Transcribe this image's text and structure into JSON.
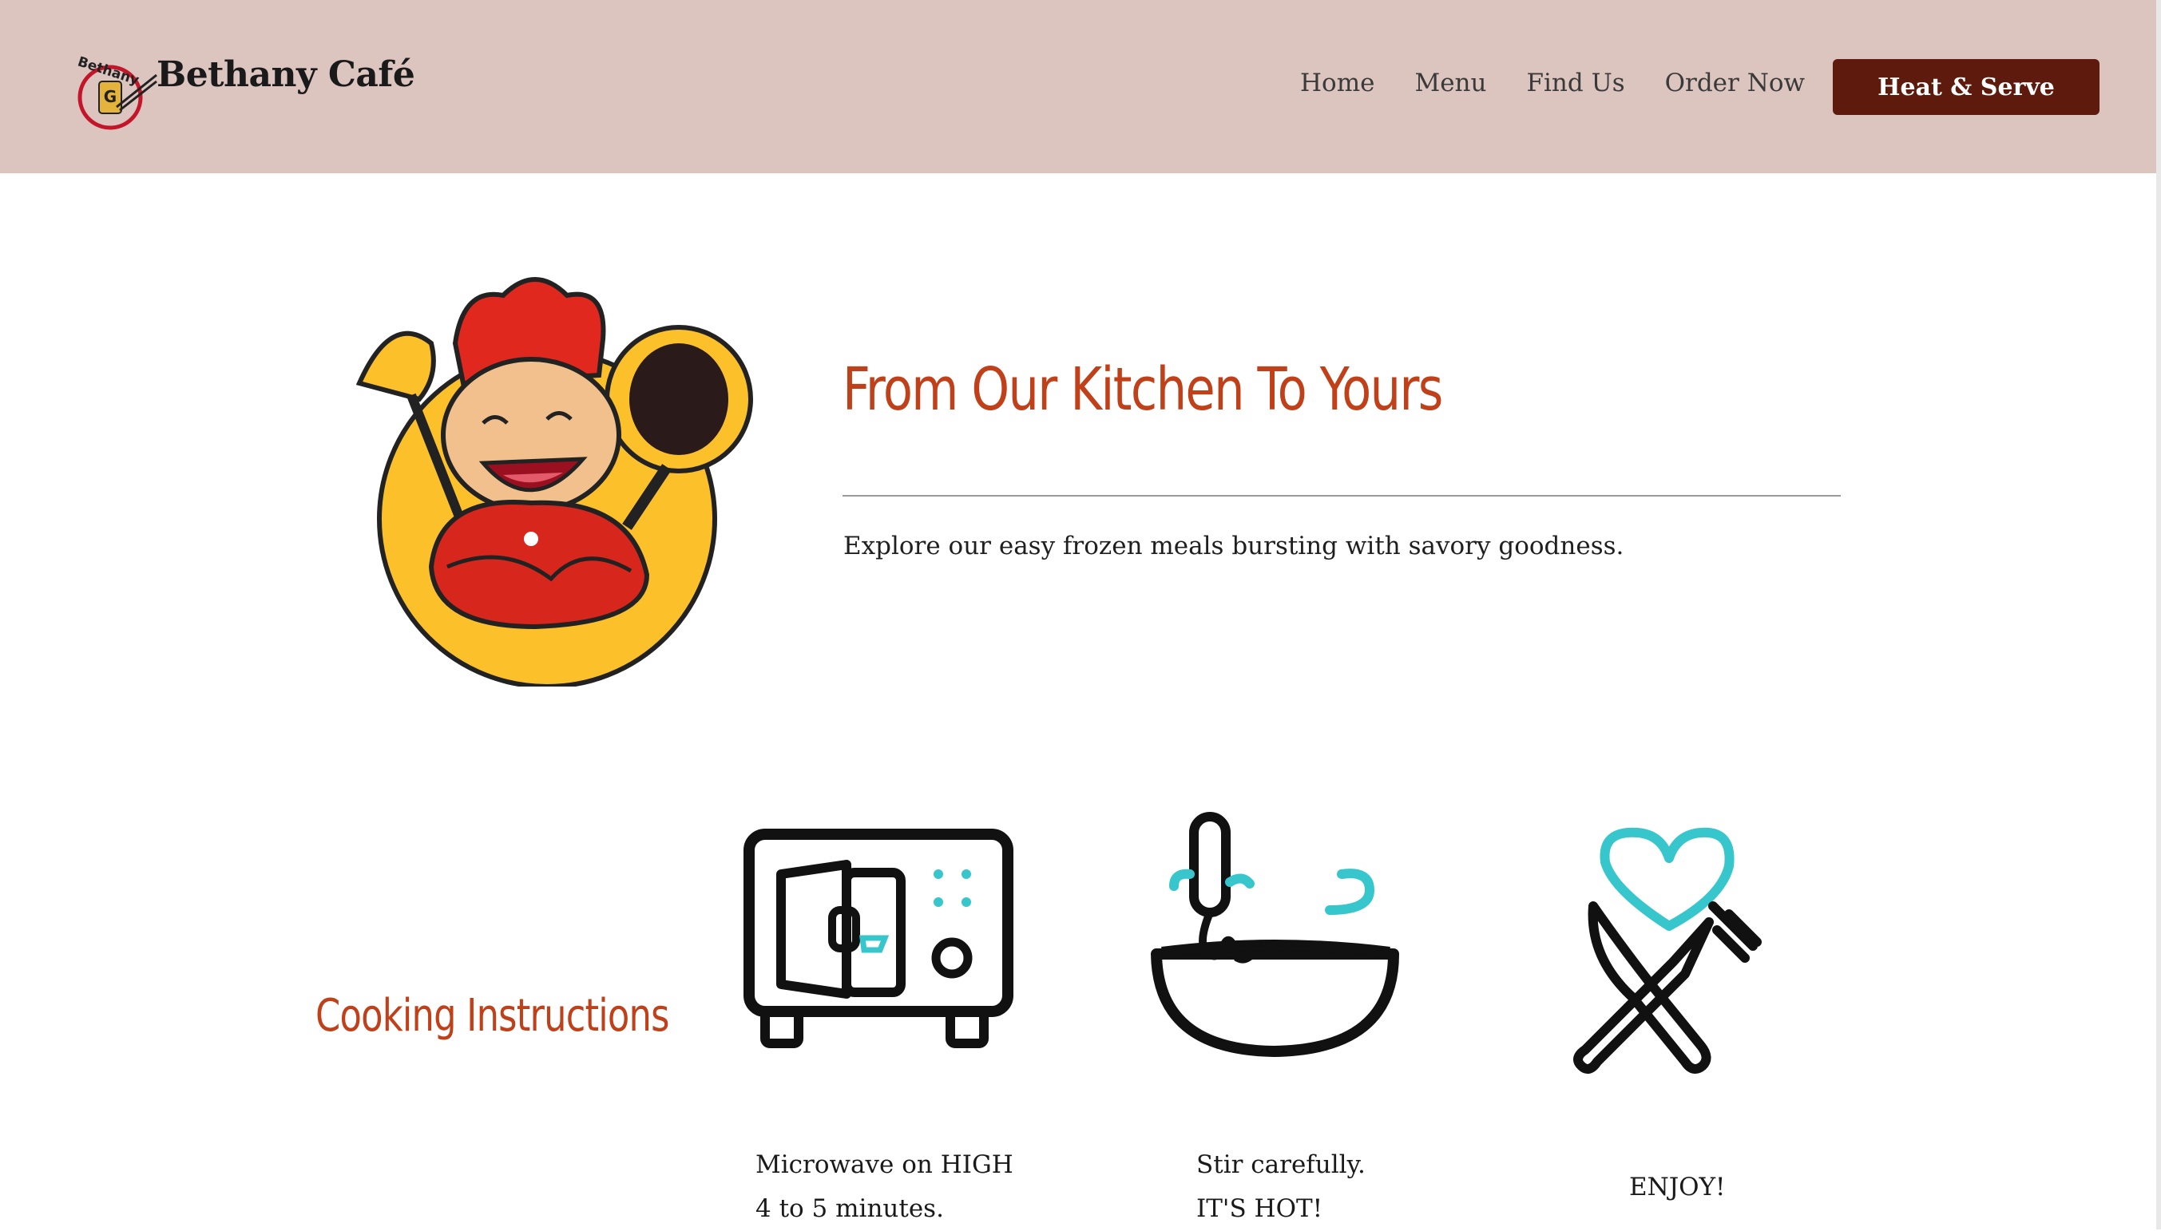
{
  "header": {
    "brand": "Bethany Café",
    "logo_arc_text": "Bethany",
    "nav": [
      "Home",
      "Menu",
      "Find Us",
      "Order Now"
    ],
    "cta_label": "Heat & Serve",
    "background": "#dcc4bf",
    "cta_color": "#5e1a0c"
  },
  "hero": {
    "title": "From Our Kitchen To Yours",
    "subtitle": "Explore our easy frozen meals bursting with savory goodness.",
    "image": "chef-mascot",
    "accent_color": "#c0401a"
  },
  "instructions": {
    "title": "Cooking Instructions",
    "steps": [
      {
        "icon": "microwave-icon",
        "line1": "Microwave on HIGH",
        "line2": "4 to 5 minutes."
      },
      {
        "icon": "whisk-bowl-icon",
        "line1": "Stir carefully.",
        "line2": "IT'S HOT!"
      },
      {
        "icon": "fork-knife-heart-icon",
        "line1": "ENJOY!"
      }
    ],
    "icon_accent": "#36c6cc"
  }
}
